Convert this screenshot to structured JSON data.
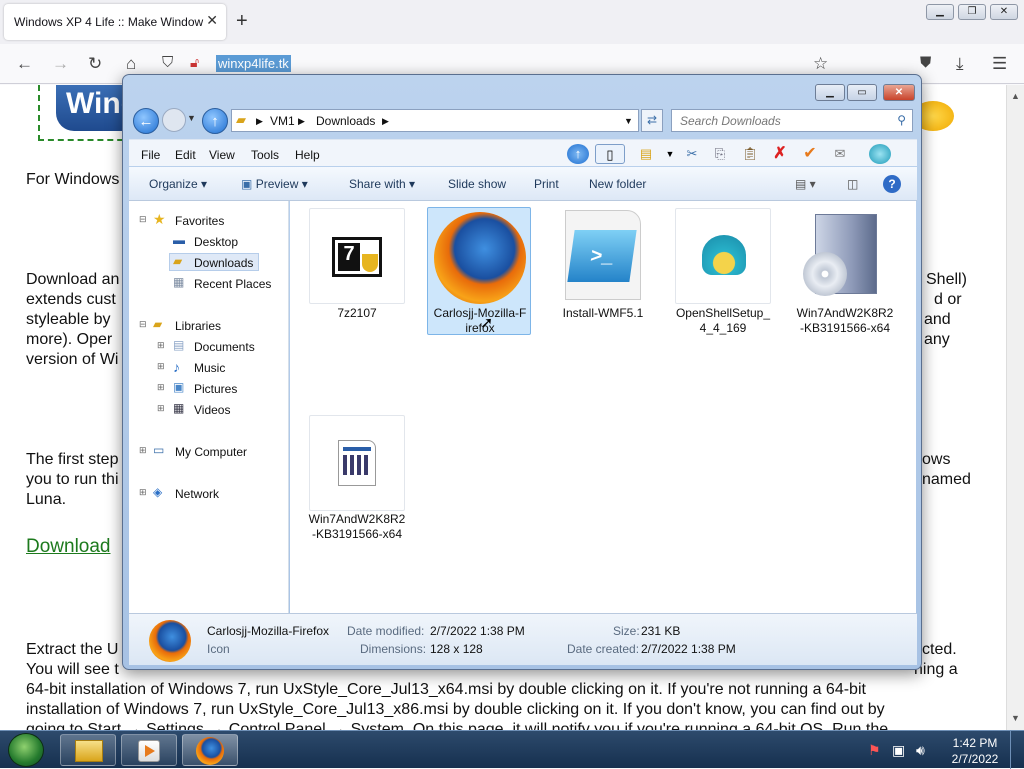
{
  "browser": {
    "tab_title": "Windows XP 4 Life :: Make Window",
    "url": "winxp4life.tk"
  },
  "page": {
    "logo_text": "Wine",
    "lines": [
      "For Windows",
      "Download an",
      "extends cust",
      "styleable by",
      "more).  Oper",
      "version of Wi",
      "Shell)",
      "d or",
      "and",
      "any",
      "The first step",
      "you to run thi",
      "Luna.",
      "ows",
      "named",
      "Extract the U",
      "You will see t",
      "cted.",
      "ning a",
      "64-bit installation of Windows 7, run UxStyle_Core_Jul13_x64.msi by double clicking on it.  If you're not running a 64-bit",
      "installation of Windows 7, run UxStyle_Core_Jul13_x86.msi by double clicking on it.  If you don't know, you can find out by",
      "going to Start → Settings → Control Panel → System.  On this page, it will notify you if you're running a 64-bit OS.  Run the"
    ],
    "link_text": "Download"
  },
  "explorer": {
    "breadcrumb": [
      "VM1",
      "Downloads"
    ],
    "search_placeholder": "Search Downloads",
    "menu": [
      "File",
      "Edit",
      "View",
      "Tools",
      "Help"
    ],
    "commands": [
      "Organize",
      "Preview",
      "Share with",
      "Slide show",
      "Print",
      "New folder"
    ],
    "nav": {
      "favorites": "Favorites",
      "desktop": "Desktop",
      "downloads": "Downloads",
      "recent": "Recent Places",
      "libraries": "Libraries",
      "documents": "Documents",
      "music": "Music",
      "pictures": "Pictures",
      "videos": "Videos",
      "computer": "My Computer",
      "network": "Network"
    },
    "files": [
      {
        "name": "7z2107",
        "icon": "7zip-icon"
      },
      {
        "name": "Carlosjj-Mozilla-Firefox",
        "icon": "firefox-icon",
        "selected": true
      },
      {
        "name": "Install-WMF5.1",
        "icon": "powershell-icon"
      },
      {
        "name": "OpenShellSetup_4_4_169",
        "icon": "shell-icon"
      },
      {
        "name": "Win7AndW2K8R2-KB3191566-x64",
        "icon": "installer-icon"
      },
      {
        "name": "Win7AndW2K8R2-KB3191566-x64",
        "icon": "msu-icon"
      }
    ],
    "file_labels": [
      [
        "7z2107"
      ],
      [
        "Carlosjj-Mozilla-F",
        "irefox"
      ],
      [
        "Install-WMF5.1"
      ],
      [
        "OpenShellSetup_",
        "4_4_169"
      ],
      [
        "Win7AndW2K8R2",
        "-KB3191566-x64"
      ],
      [
        "Win7AndW2K8R2",
        "-KB3191566-x64"
      ]
    ],
    "details": {
      "name": "Carlosjj-Mozilla-Firefox",
      "type": "Icon",
      "date_modified_label": "Date modified:",
      "date_modified": "2/7/2022 1:38 PM",
      "dimensions_label": "Dimensions:",
      "dimensions": "128 x 128",
      "size_label": "Size:",
      "size": "231 KB",
      "date_created_label": "Date created:",
      "date_created": "2/7/2022 1:38 PM"
    }
  },
  "taskbar": {
    "time": "1:42 PM",
    "date": "2/7/2022"
  }
}
